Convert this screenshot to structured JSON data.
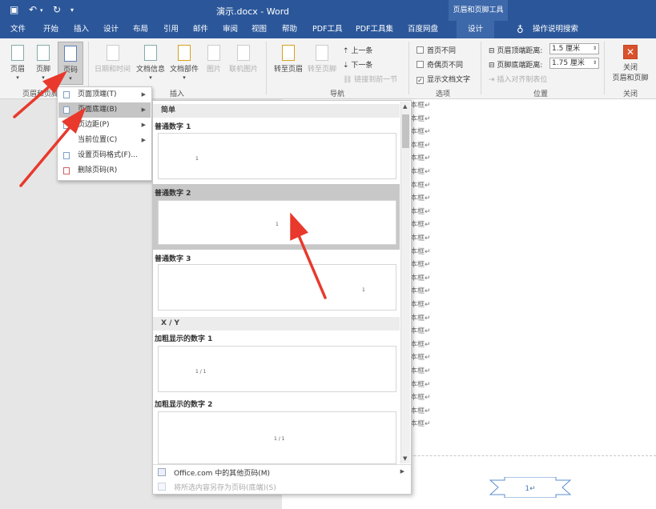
{
  "title_bar": {
    "save_icon": "save-icon",
    "undo_icon": "undo-icon",
    "redo_icon": "redo-icon",
    "doc_title": "演示.docx  -  Word",
    "context_tab": "页眉和页脚工具"
  },
  "tabs": [
    "文件",
    "开始",
    "插入",
    "设计",
    "布局",
    "引用",
    "邮件",
    "审阅",
    "视图",
    "帮助",
    "PDF工具",
    "PDF工具集",
    "百度网盘",
    "设计",
    "操作说明搜索"
  ],
  "ribbon": {
    "header": "页眉",
    "footer": "页脚",
    "page_number": "页码",
    "group_header_footer": "页眉和页脚",
    "date_time": "日期和时间",
    "doc_info": "文档信息",
    "doc_parts": "文档部件",
    "picture": "图片",
    "online_picture": "联机图片",
    "group_insert": "插入",
    "goto_header": "转至页眉",
    "goto_footer": "转至页脚",
    "prev": "上一条",
    "next": "下一条",
    "link_prev": "链接到前一节",
    "group_nav": "导航",
    "first_page_diff": "首页不同",
    "odd_even_diff": "奇偶页不同",
    "show_doc_text": "显示文档文字",
    "group_options": "选项",
    "header_top_label": "页眉顶端距离:",
    "header_top_value": "1.5 厘米",
    "footer_bottom_label": "页脚底端距离:",
    "footer_bottom_value": "1.75 厘米",
    "insert_align_tab": "插入对齐制表位",
    "group_position": "位置",
    "close_line1": "关闭",
    "close_line2": "页眉和页脚",
    "group_close": "关闭"
  },
  "menu": {
    "items": [
      "页面顶端(T)",
      "页面底端(B)",
      "页边距(P)",
      "当前位置(C)",
      "设置页码格式(F)...",
      "删除页码(R)"
    ]
  },
  "gallery": {
    "section1": "简单",
    "item1": "普通数字 1",
    "item2": "普通数字 2",
    "item3": "普通数字 3",
    "num": "1",
    "section2": "X / Y",
    "item4": "加粗显示的数字 1",
    "item5": "加粗显示的数字 2",
    "xy": "1 / 1",
    "more": "Office.com 中的其他页码(M)",
    "save_sel": "将所选内容另存为页码(底端)(S)"
  },
  "document": {
    "line_text": "本框↵",
    "footer_number": "1↵"
  },
  "colors": {
    "title_bar": "#2b579a",
    "context_tab": "#3d68aa",
    "annotation_arrow": "#e8392c",
    "close_icon": "#d9522c"
  }
}
